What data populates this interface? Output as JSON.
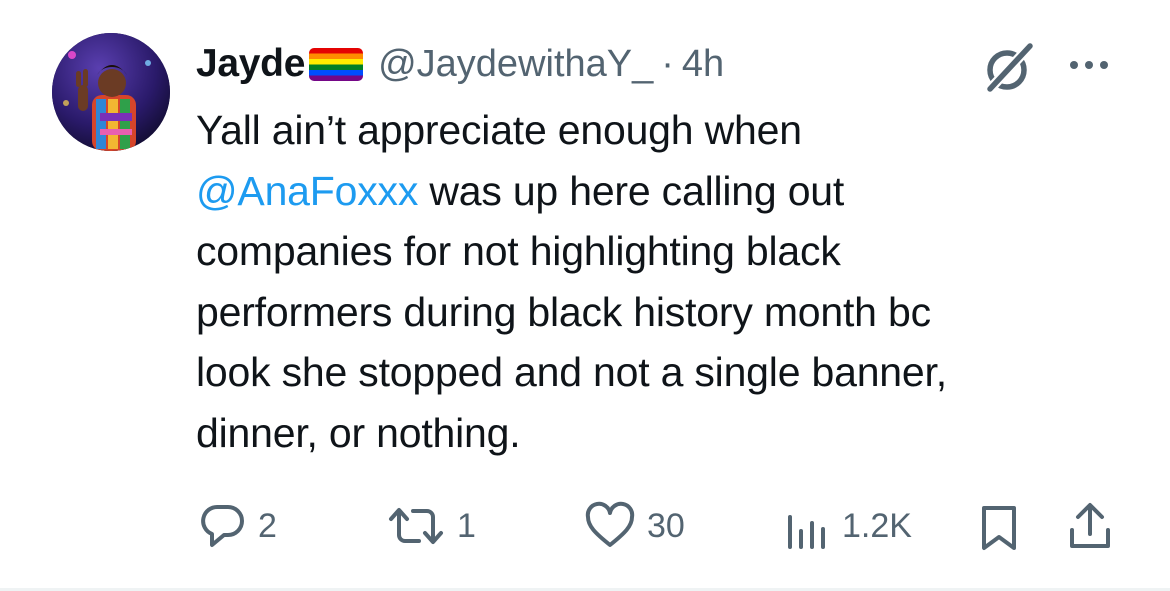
{
  "tweet": {
    "author": {
      "display_name": "Jayde",
      "flag_icon": "rainbow-pride-flag",
      "handle": "@JaydewithaY_",
      "separator": "·",
      "time": "4h"
    },
    "text": {
      "line1": "Yall ain’t appreciate enough when",
      "mention": "@AnaFoxxx",
      "line2_rest": " was up here calling out",
      "line3": "companies for not highlighting black",
      "line4": "performers during black history month bc",
      "line5": "look she stopped and not a single banner,",
      "line6": "dinner, or nothing."
    },
    "actions": {
      "replies": "2",
      "reposts": "1",
      "likes": "30",
      "views": "1.2K"
    },
    "icons": {
      "reply": "reply-bubble-icon",
      "repost": "repost-icon",
      "like": "heart-icon",
      "views": "analytics-bars-icon",
      "bookmark": "bookmark-icon",
      "share": "share-upload-icon",
      "grok": "grok-icon",
      "more": "more-dots-icon"
    },
    "colors": {
      "text": "#0f1419",
      "secondary": "#536471",
      "link": "#1d9bf0"
    }
  }
}
